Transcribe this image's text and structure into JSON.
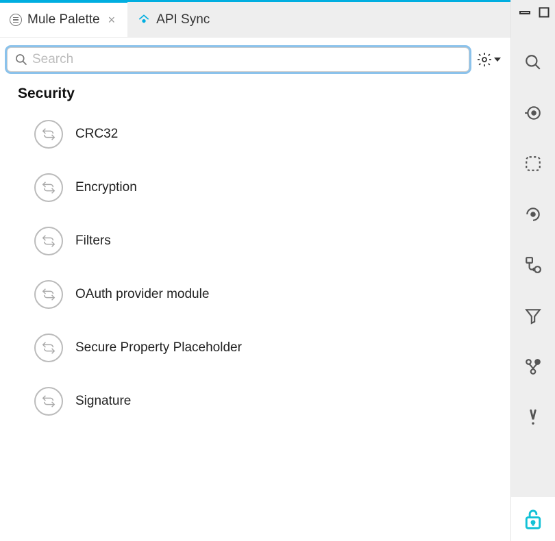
{
  "tabs": [
    {
      "label": "Mule Palette",
      "active": true,
      "closable": true
    },
    {
      "label": "API Sync",
      "active": false,
      "closable": false
    }
  ],
  "search": {
    "placeholder": "Search",
    "value": ""
  },
  "category": {
    "title": "Security",
    "items": [
      {
        "label": "CRC32"
      },
      {
        "label": "Encryption"
      },
      {
        "label": "Filters"
      },
      {
        "label": "OAuth provider module"
      },
      {
        "label": "Secure Property Placeholder"
      },
      {
        "label": "Signature"
      }
    ]
  },
  "colors": {
    "accent": "#00aee0",
    "iconStroke": "#555555",
    "lockAccent": "#12c1d6"
  }
}
